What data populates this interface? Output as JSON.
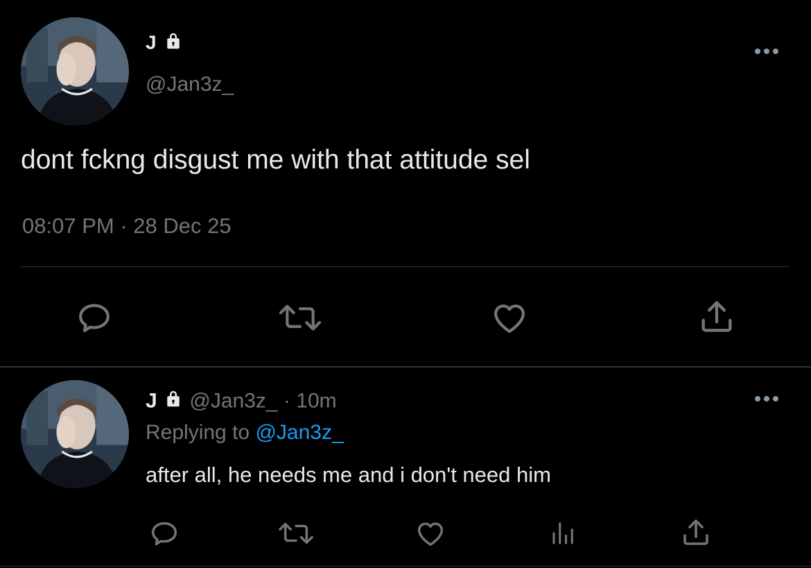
{
  "tweet": {
    "display_name": "J",
    "handle": "@Jan3z_",
    "text": "dont fckng disgust me with that attitude sel",
    "timestamp": "08:07 PM · 28 Dec 25"
  },
  "reply": {
    "display_name": "J",
    "handle": "@Jan3z_",
    "separator": "·",
    "age": "10m",
    "replying_label": "Replying to",
    "replying_handle": "@Jan3z_",
    "text": "after all, he needs me and i don't need him"
  },
  "icons": {
    "lock": "lock-icon",
    "more": "more-icon",
    "reply": "reply-icon",
    "retweet": "retweet-icon",
    "like": "like-icon",
    "share": "share-icon",
    "analytics": "analytics-icon"
  },
  "colors": {
    "background": "#000000",
    "text": "#e7e9ea",
    "muted": "#71767b",
    "link": "#1d9bf0",
    "divider": "#2f3336"
  }
}
